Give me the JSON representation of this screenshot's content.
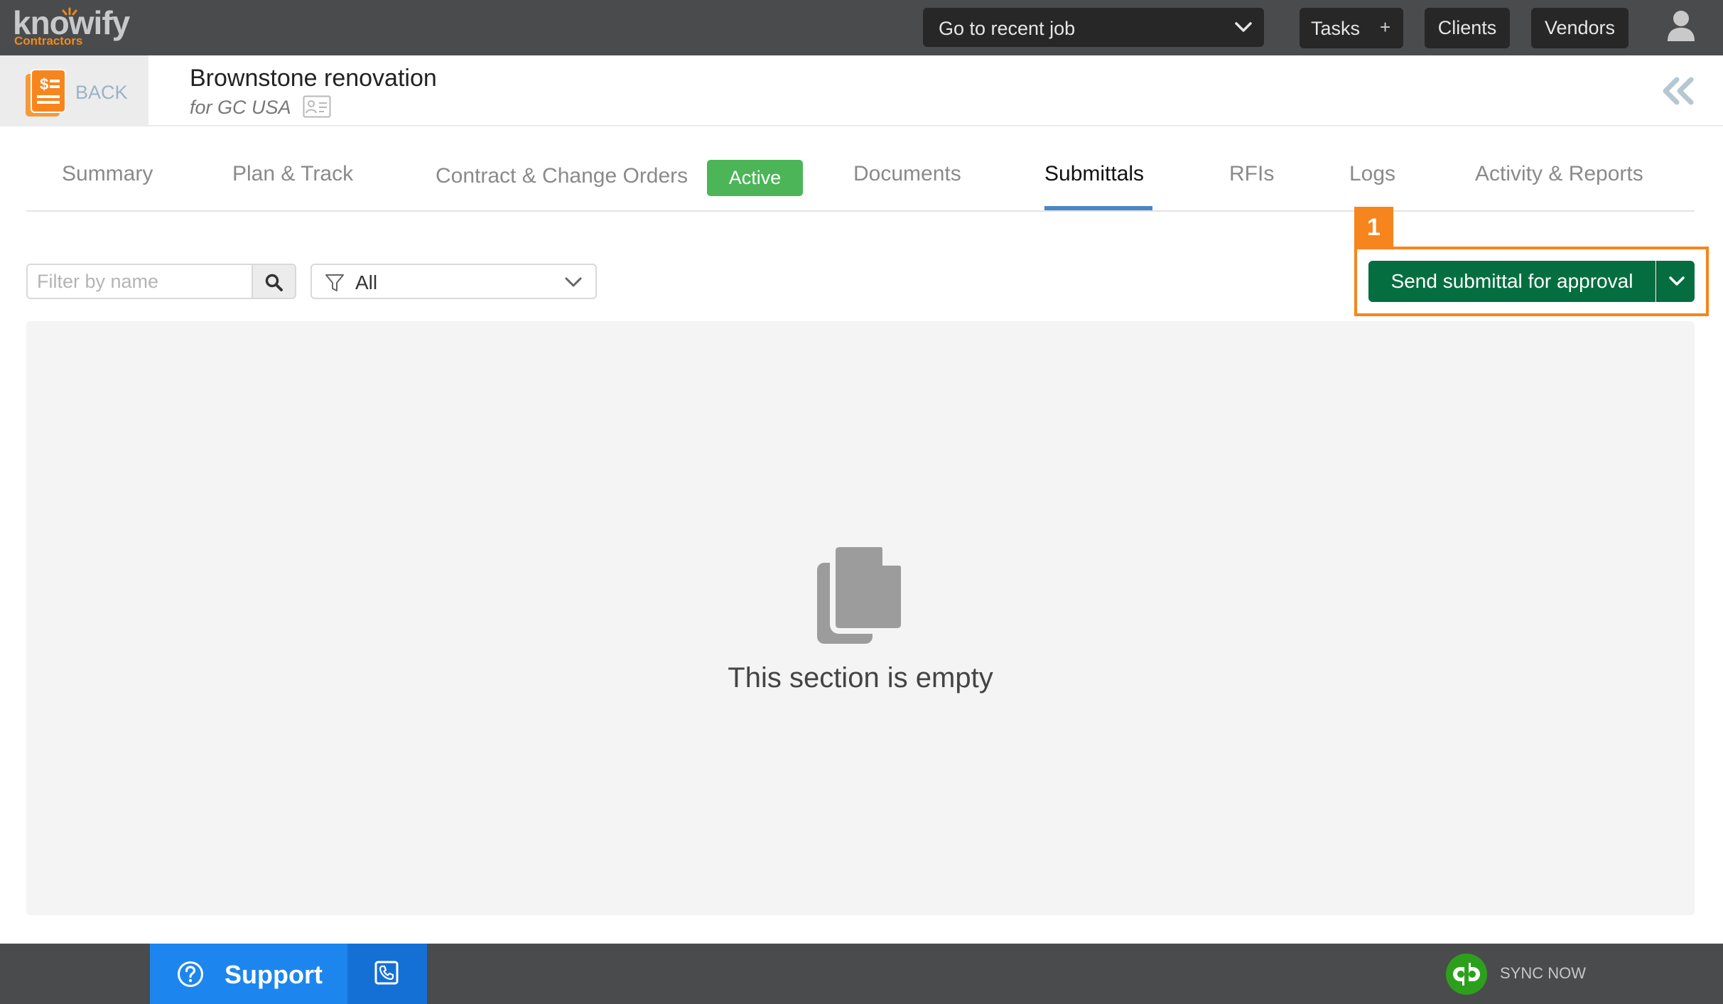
{
  "topbar": {
    "logo_text": "knowify",
    "logo_subtext": "Contractors",
    "recent_job_label": "Go to recent job",
    "tasks_label": "Tasks",
    "tasks_add_glyph": "+",
    "clients_label": "Clients",
    "vendors_label": "Vendors",
    "icons": [
      "chevron-down-icon",
      "plus-icon",
      "user-icon"
    ]
  },
  "job": {
    "back_label": "BACK",
    "title": "Brownstone renovation",
    "client": "for GC USA",
    "icons": [
      "invoice-document-icon",
      "contact-card-icon",
      "collapse-double-chevron-icon"
    ]
  },
  "tabs": [
    {
      "label": "Summary",
      "active": false
    },
    {
      "label": "Plan & Track",
      "active": false
    },
    {
      "label": "Contract & Change Orders",
      "active": false,
      "badge": "Active"
    },
    {
      "label": "Documents",
      "active": false
    },
    {
      "label": "Submittals",
      "active": true
    },
    {
      "label": "RFIs",
      "active": false
    },
    {
      "label": "Logs",
      "active": false
    },
    {
      "label": "Activity & Reports",
      "active": false
    }
  ],
  "filters": {
    "name_placeholder": "Filter by name",
    "name_value": "",
    "status_value": "All"
  },
  "action": {
    "step_number": "1",
    "send_label": "Send submittal for approval"
  },
  "empty_state": {
    "message": "This section is empty"
  },
  "footer": {
    "support_label": "Support",
    "sync_label": "SYNC NOW"
  },
  "colors": {
    "topbar": "#4a4b4d",
    "nav_button": "#272727",
    "brand_orange": "#f08a1c",
    "highlight_orange": "#f7851e",
    "active_badge_green": "#4bb557",
    "primary_green": "#056e40",
    "tab_underline": "#4a86c5",
    "support_blue": "#1d86ee",
    "quickbooks_green": "#2ca01c"
  }
}
